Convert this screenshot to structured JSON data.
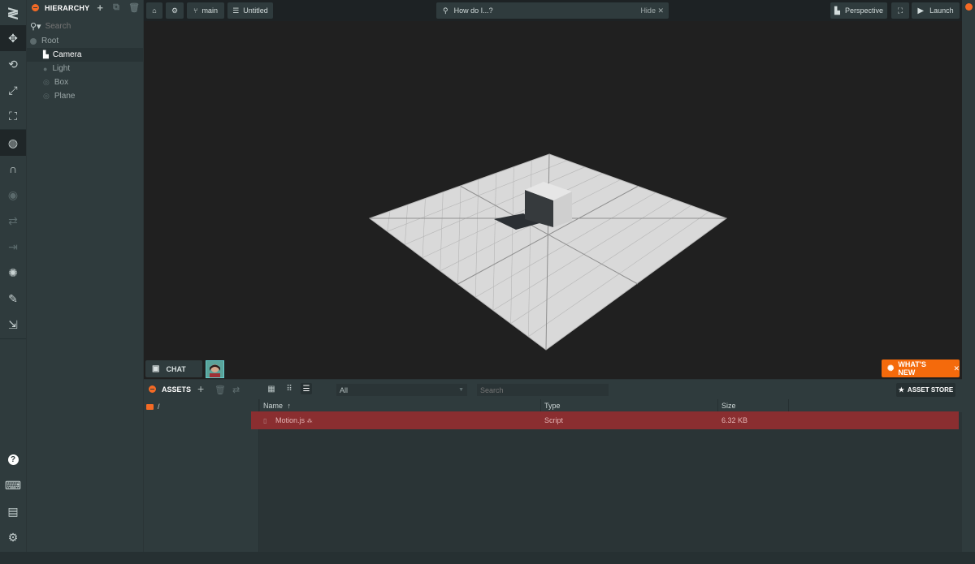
{
  "toolbar": {
    "tools": [
      {
        "name": "logo-icon",
        "glyph": "≷"
      },
      {
        "name": "translate-icon",
        "glyph": "✥"
      },
      {
        "name": "rotate-icon",
        "glyph": "⟲"
      },
      {
        "name": "scale-icon",
        "glyph": "⤢"
      },
      {
        "name": "resize-icon",
        "glyph": "⛶"
      },
      {
        "name": "world-icon",
        "glyph": "◍"
      },
      {
        "name": "magnet-icon",
        "glyph": "∩"
      },
      {
        "name": "eye-icon",
        "glyph": "◉"
      },
      {
        "name": "undo-icon",
        "glyph": "⇄"
      },
      {
        "name": "redo-icon",
        "glyph": "⇥"
      },
      {
        "name": "light-icon",
        "glyph": "✺"
      },
      {
        "name": "edit-icon",
        "glyph": "✎"
      },
      {
        "name": "publish-icon",
        "glyph": "⇲"
      }
    ],
    "bottom_tools": [
      {
        "name": "help-icon",
        "glyph": "?"
      },
      {
        "name": "controls-icon",
        "glyph": "⌨"
      },
      {
        "name": "feedback-icon",
        "glyph": "▤"
      },
      {
        "name": "settings-icon",
        "glyph": "⚙"
      }
    ]
  },
  "hierarchy": {
    "title": "HIERARCHY",
    "search_placeholder": "Search",
    "items": [
      {
        "label": "Root",
        "icon": "root-icon"
      },
      {
        "label": "Camera",
        "icon": "camera-icon"
      },
      {
        "label": "Light",
        "icon": "light-bulb-icon"
      },
      {
        "label": "Box",
        "icon": "entity-icon"
      },
      {
        "label": "Plane",
        "icon": "entity-icon"
      }
    ]
  },
  "topbar": {
    "branch": "main",
    "scene": "Untitled",
    "search_placeholder": "How do I...?",
    "hide_label": "Hide",
    "camera_label": "Perspective",
    "launch_label": "Launch"
  },
  "chat": {
    "label": "CHAT"
  },
  "whats_new": {
    "label": "WHAT'S NEW"
  },
  "assets": {
    "title": "ASSETS",
    "filter": "All",
    "search_placeholder": "Search",
    "store_label": "ASSET STORE",
    "folder": "/",
    "columns": {
      "name": "Name",
      "type": "Type",
      "size": "Size"
    },
    "rows": [
      {
        "name": "Motion.js",
        "type": "Script",
        "size": "6.32 KB"
      }
    ]
  },
  "colors": {
    "accent": "#f46a25",
    "selection_row": "#8a2e30",
    "panel": "#2f3b3d",
    "viewport": "#202020"
  }
}
